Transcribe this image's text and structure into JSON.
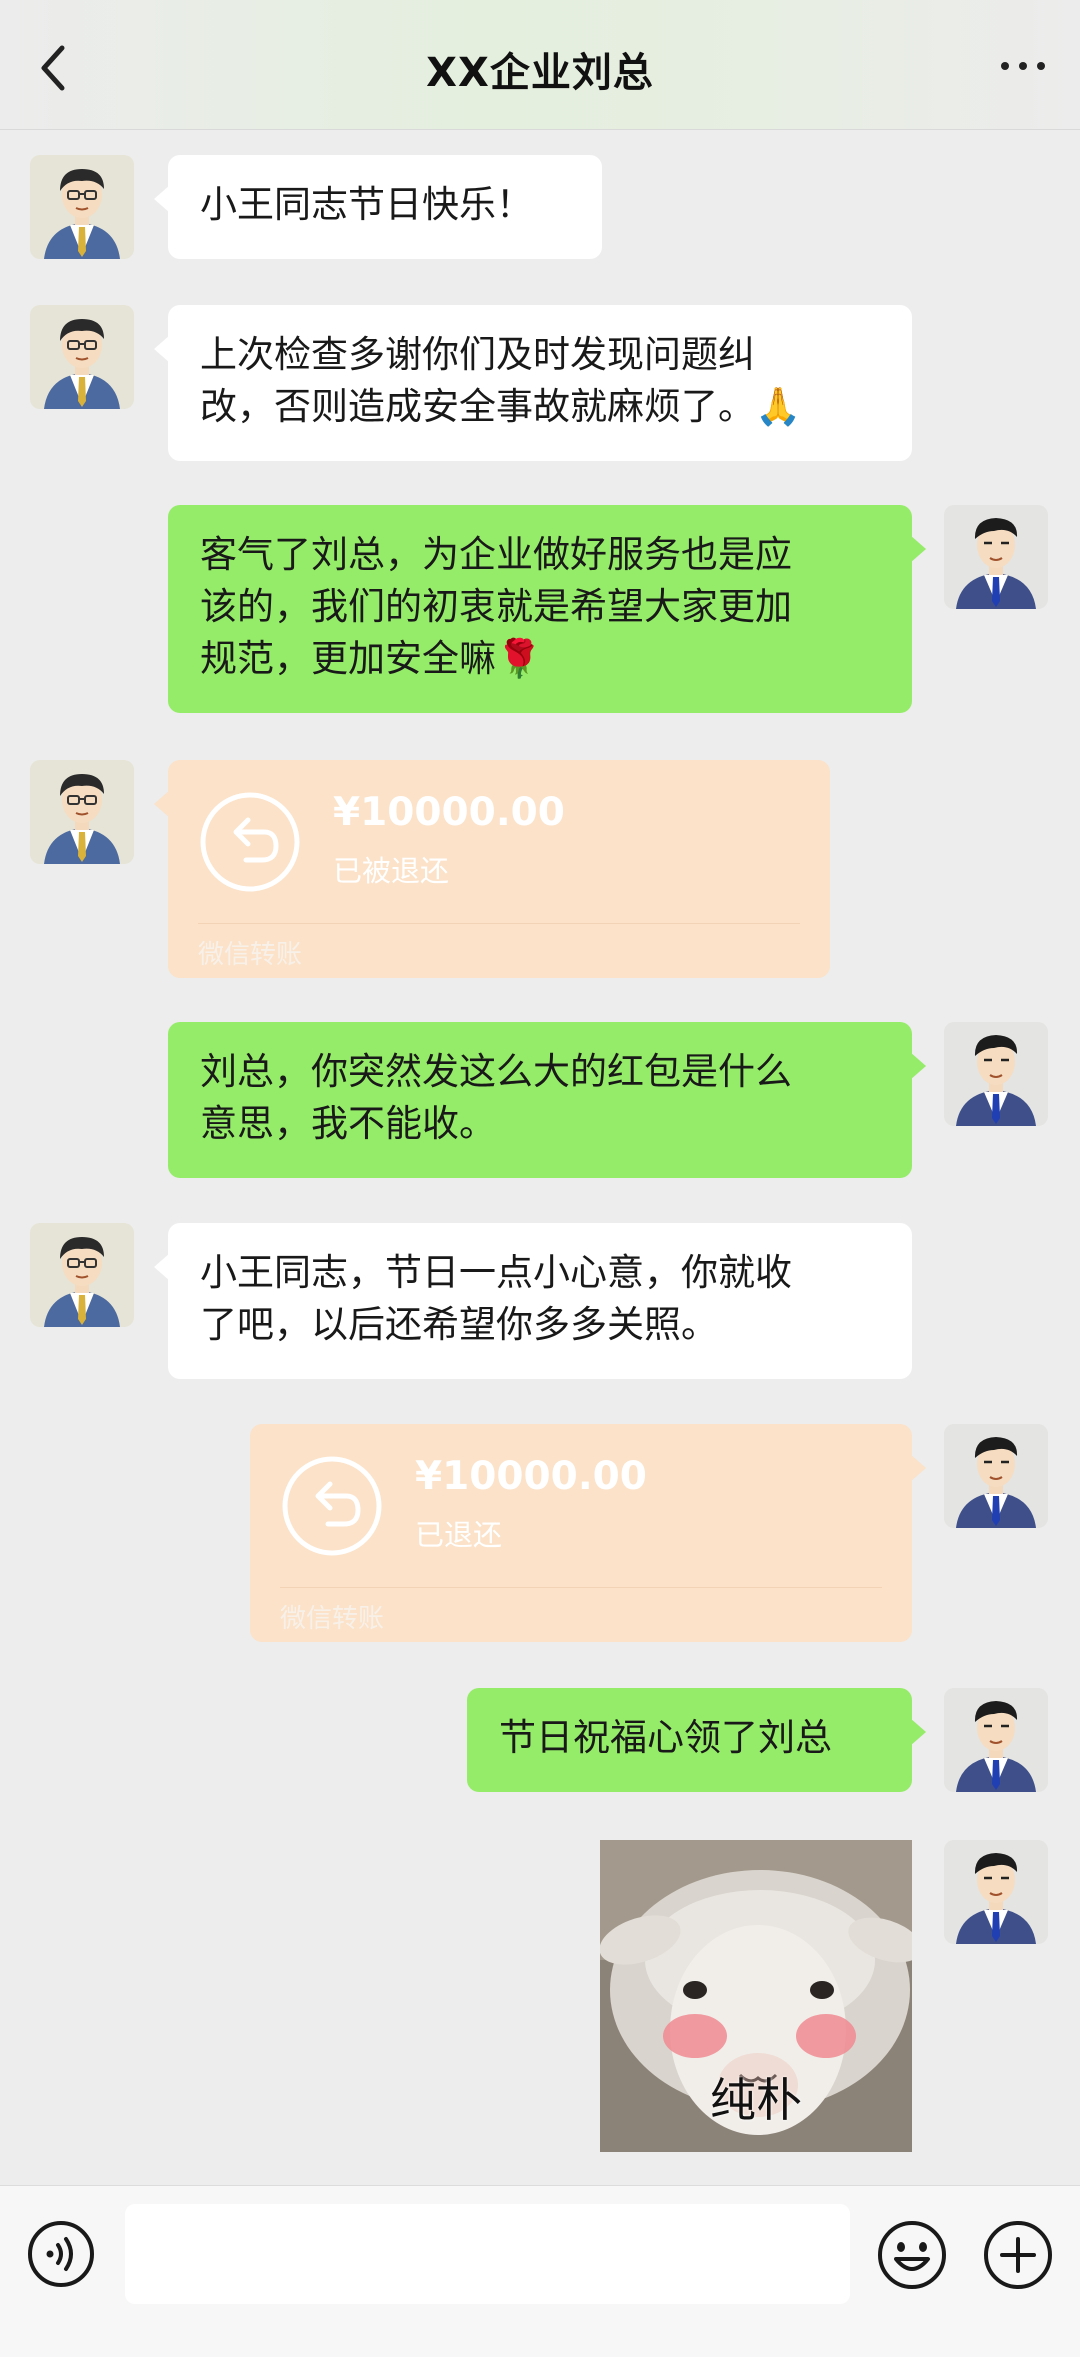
{
  "header": {
    "title": "XX企业刘总"
  },
  "messages": [
    {
      "side": "left",
      "type": "text",
      "text": "小王同志节日快乐！"
    },
    {
      "side": "left",
      "type": "text",
      "line1": "上次检查多谢你们及时发现问题纠",
      "line2": "改，否则造成安全事故就麻烦了。",
      "emoji": "🙏"
    },
    {
      "side": "right",
      "type": "text",
      "line1": "客气了刘总，为企业做好服务也是应",
      "line2": "该的，我们的初衷就是希望大家更加",
      "line3": "规范，更加安全嘛",
      "emoji": "🌹"
    },
    {
      "side": "left",
      "type": "transfer",
      "amount": "¥10000.00",
      "status": "已被退还",
      "label": "微信转账"
    },
    {
      "side": "right",
      "type": "text",
      "line1": "刘总，你突然发这么大的红包是什么",
      "line2": "意思，我不能收。"
    },
    {
      "side": "left",
      "type": "text",
      "line1": "小王同志，节日一点小心意，你就收",
      "line2": "了吧，以后还希望你多多关照。"
    },
    {
      "side": "right",
      "type": "transfer",
      "amount": "¥10000.00",
      "status": "已退还",
      "label": "微信转账"
    },
    {
      "side": "right",
      "type": "text",
      "text": "节日祝福心领了刘总"
    },
    {
      "side": "right",
      "type": "sticker",
      "caption": "纯朴",
      "icon": "sheep-sticker"
    }
  ],
  "input": {
    "value": "",
    "placeholder": ""
  },
  "icons": {
    "back": "chevron-left-icon",
    "more": "more-dots-icon",
    "voice": "voice-icon",
    "emoji": "emoji-icon",
    "plus": "plus-icon",
    "transfer": "return-arrow-icon"
  },
  "colors": {
    "background": "#ededed",
    "bubble_sent": "#95ec69",
    "bubble_received": "#ffffff",
    "transfer_returned": "#fbe2c8"
  }
}
